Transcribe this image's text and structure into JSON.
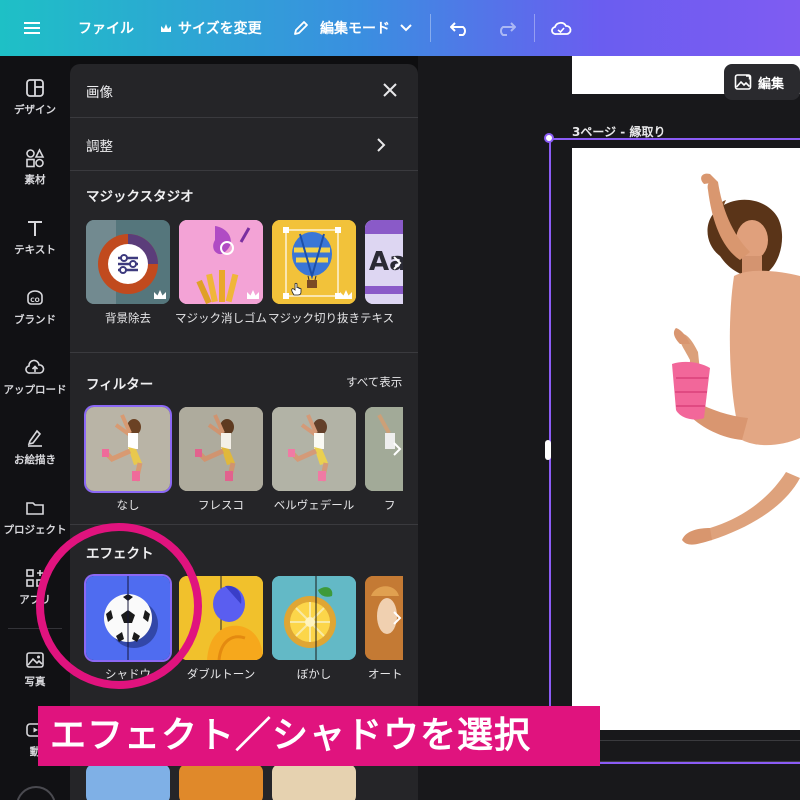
{
  "toolbar": {
    "menu_icon": "hamburger-icon",
    "file_label": "ファイル",
    "resize_label": "サイズを変更",
    "edit_mode_label": "編集モード",
    "undo_icon": "undo-icon",
    "redo_icon": "redo-icon",
    "cloud_icon": "cloud-check-icon"
  },
  "sidebar": {
    "items": [
      {
        "label": "デザイン",
        "icon": "design-icon"
      },
      {
        "label": "素材",
        "icon": "elements-icon"
      },
      {
        "label": "テキスト",
        "icon": "text-icon"
      },
      {
        "label": "ブランド",
        "icon": "brand-icon"
      },
      {
        "label": "アップロード",
        "icon": "upload-icon"
      },
      {
        "label": "お絵描き",
        "icon": "draw-icon"
      },
      {
        "label": "プロジェクト",
        "icon": "folder-icon"
      },
      {
        "label": "アプリ",
        "icon": "apps-icon"
      },
      {
        "label": "写真",
        "icon": "photo-icon"
      },
      {
        "label": "動",
        "icon": "video-icon"
      }
    ]
  },
  "panel": {
    "title": "画像",
    "adjust_label": "調整",
    "magic": {
      "title": "マジックスタジオ",
      "items": [
        "背景除去",
        "マジック消しゴム",
        "マジック切り抜き",
        "テキス"
      ]
    },
    "filter": {
      "title": "フィルター",
      "see_all": "すべて表示",
      "items": [
        "なし",
        "フレスコ",
        "ベルヴェデール",
        "フ"
      ]
    },
    "effects": {
      "title": "エフェクト",
      "items": [
        "シャドウ",
        "ダブルトーン",
        "ぼかし",
        "オート"
      ]
    }
  },
  "canvas": {
    "edit_label": "編集",
    "page_label": "3ページ - 縁取り"
  },
  "annotation": {
    "text": "エフェクト／シャドウを選択",
    "color": "#e0137e"
  },
  "colors": {
    "accent": "#8b5cf6",
    "panel_bg": "#252528"
  }
}
